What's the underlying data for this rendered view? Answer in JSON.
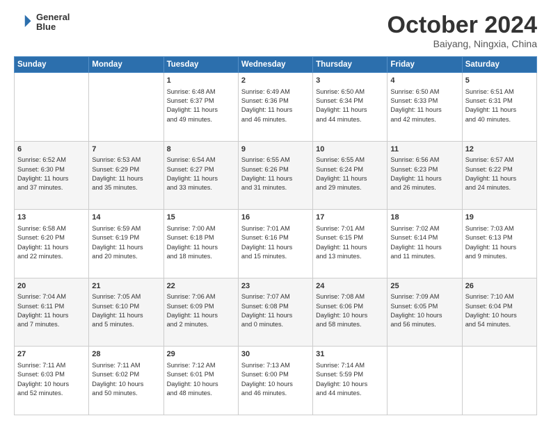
{
  "logo": {
    "line1": "General",
    "line2": "Blue"
  },
  "title": "October 2024",
  "subtitle": "Baiyang, Ningxia, China",
  "header_days": [
    "Sunday",
    "Monday",
    "Tuesday",
    "Wednesday",
    "Thursday",
    "Friday",
    "Saturday"
  ],
  "weeks": [
    [
      {
        "day": "",
        "info": ""
      },
      {
        "day": "",
        "info": ""
      },
      {
        "day": "1",
        "info": "Sunrise: 6:48 AM\nSunset: 6:37 PM\nDaylight: 11 hours\nand 49 minutes."
      },
      {
        "day": "2",
        "info": "Sunrise: 6:49 AM\nSunset: 6:36 PM\nDaylight: 11 hours\nand 46 minutes."
      },
      {
        "day": "3",
        "info": "Sunrise: 6:50 AM\nSunset: 6:34 PM\nDaylight: 11 hours\nand 44 minutes."
      },
      {
        "day": "4",
        "info": "Sunrise: 6:50 AM\nSunset: 6:33 PM\nDaylight: 11 hours\nand 42 minutes."
      },
      {
        "day": "5",
        "info": "Sunrise: 6:51 AM\nSunset: 6:31 PM\nDaylight: 11 hours\nand 40 minutes."
      }
    ],
    [
      {
        "day": "6",
        "info": "Sunrise: 6:52 AM\nSunset: 6:30 PM\nDaylight: 11 hours\nand 37 minutes."
      },
      {
        "day": "7",
        "info": "Sunrise: 6:53 AM\nSunset: 6:29 PM\nDaylight: 11 hours\nand 35 minutes."
      },
      {
        "day": "8",
        "info": "Sunrise: 6:54 AM\nSunset: 6:27 PM\nDaylight: 11 hours\nand 33 minutes."
      },
      {
        "day": "9",
        "info": "Sunrise: 6:55 AM\nSunset: 6:26 PM\nDaylight: 11 hours\nand 31 minutes."
      },
      {
        "day": "10",
        "info": "Sunrise: 6:55 AM\nSunset: 6:24 PM\nDaylight: 11 hours\nand 29 minutes."
      },
      {
        "day": "11",
        "info": "Sunrise: 6:56 AM\nSunset: 6:23 PM\nDaylight: 11 hours\nand 26 minutes."
      },
      {
        "day": "12",
        "info": "Sunrise: 6:57 AM\nSunset: 6:22 PM\nDaylight: 11 hours\nand 24 minutes."
      }
    ],
    [
      {
        "day": "13",
        "info": "Sunrise: 6:58 AM\nSunset: 6:20 PM\nDaylight: 11 hours\nand 22 minutes."
      },
      {
        "day": "14",
        "info": "Sunrise: 6:59 AM\nSunset: 6:19 PM\nDaylight: 11 hours\nand 20 minutes."
      },
      {
        "day": "15",
        "info": "Sunrise: 7:00 AM\nSunset: 6:18 PM\nDaylight: 11 hours\nand 18 minutes."
      },
      {
        "day": "16",
        "info": "Sunrise: 7:01 AM\nSunset: 6:16 PM\nDaylight: 11 hours\nand 15 minutes."
      },
      {
        "day": "17",
        "info": "Sunrise: 7:01 AM\nSunset: 6:15 PM\nDaylight: 11 hours\nand 13 minutes."
      },
      {
        "day": "18",
        "info": "Sunrise: 7:02 AM\nSunset: 6:14 PM\nDaylight: 11 hours\nand 11 minutes."
      },
      {
        "day": "19",
        "info": "Sunrise: 7:03 AM\nSunset: 6:13 PM\nDaylight: 11 hours\nand 9 minutes."
      }
    ],
    [
      {
        "day": "20",
        "info": "Sunrise: 7:04 AM\nSunset: 6:11 PM\nDaylight: 11 hours\nand 7 minutes."
      },
      {
        "day": "21",
        "info": "Sunrise: 7:05 AM\nSunset: 6:10 PM\nDaylight: 11 hours\nand 5 minutes."
      },
      {
        "day": "22",
        "info": "Sunrise: 7:06 AM\nSunset: 6:09 PM\nDaylight: 11 hours\nand 2 minutes."
      },
      {
        "day": "23",
        "info": "Sunrise: 7:07 AM\nSunset: 6:08 PM\nDaylight: 11 hours\nand 0 minutes."
      },
      {
        "day": "24",
        "info": "Sunrise: 7:08 AM\nSunset: 6:06 PM\nDaylight: 10 hours\nand 58 minutes."
      },
      {
        "day": "25",
        "info": "Sunrise: 7:09 AM\nSunset: 6:05 PM\nDaylight: 10 hours\nand 56 minutes."
      },
      {
        "day": "26",
        "info": "Sunrise: 7:10 AM\nSunset: 6:04 PM\nDaylight: 10 hours\nand 54 minutes."
      }
    ],
    [
      {
        "day": "27",
        "info": "Sunrise: 7:11 AM\nSunset: 6:03 PM\nDaylight: 10 hours\nand 52 minutes."
      },
      {
        "day": "28",
        "info": "Sunrise: 7:11 AM\nSunset: 6:02 PM\nDaylight: 10 hours\nand 50 minutes."
      },
      {
        "day": "29",
        "info": "Sunrise: 7:12 AM\nSunset: 6:01 PM\nDaylight: 10 hours\nand 48 minutes."
      },
      {
        "day": "30",
        "info": "Sunrise: 7:13 AM\nSunset: 6:00 PM\nDaylight: 10 hours\nand 46 minutes."
      },
      {
        "day": "31",
        "info": "Sunrise: 7:14 AM\nSunset: 5:59 PM\nDaylight: 10 hours\nand 44 minutes."
      },
      {
        "day": "",
        "info": ""
      },
      {
        "day": "",
        "info": ""
      }
    ]
  ]
}
